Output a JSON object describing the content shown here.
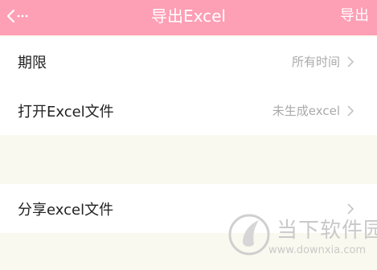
{
  "header": {
    "back_icon": "chevron-left-dots-icon",
    "title": "导出Excel",
    "export_label": "导出"
  },
  "settings": {
    "rows": [
      {
        "label": "期限",
        "value": "所有时间"
      },
      {
        "label": "打开Excel文件",
        "value": "未生成excel"
      },
      {
        "label": "分享excel文件",
        "value": ""
      }
    ]
  },
  "watermark": {
    "brand": "当下软件园",
    "url": "www.downxia.com"
  },
  "colors": {
    "header_bg": "#fd9fb5",
    "page_bg": "#faf9ef",
    "row_bg": "#ffffff",
    "value_text": "#aaaaaa"
  }
}
